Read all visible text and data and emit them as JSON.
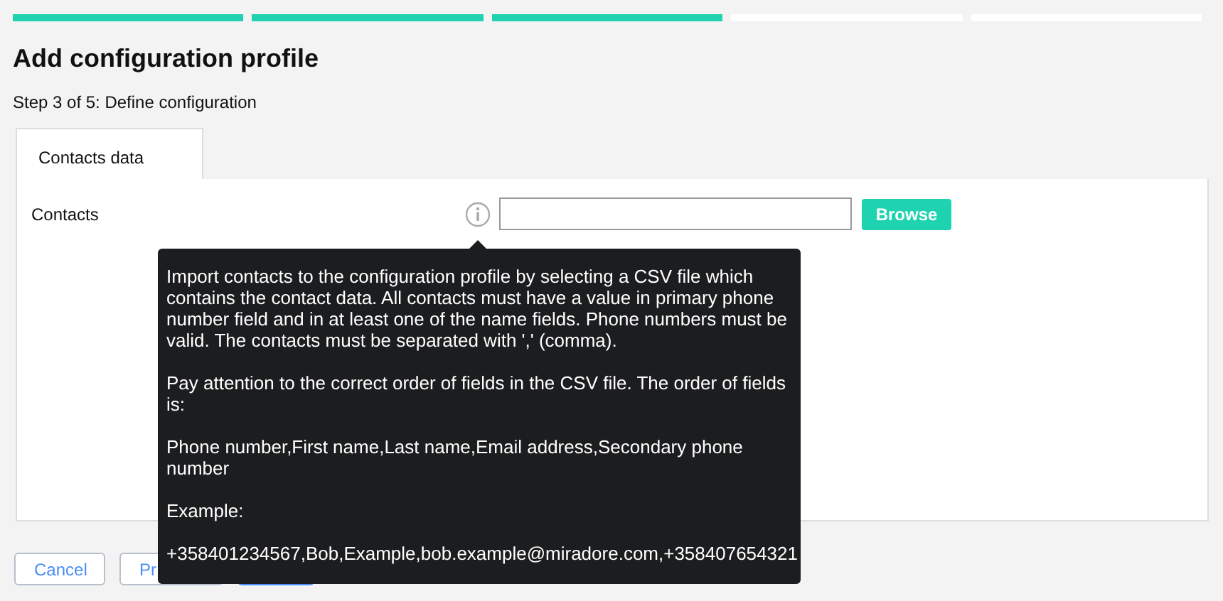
{
  "steps": [
    {
      "done": true
    },
    {
      "done": true
    },
    {
      "done": true
    },
    {
      "done": false
    },
    {
      "done": false
    }
  ],
  "title": "Add configuration profile",
  "subtitle": "Step 3 of 5: Define configuration",
  "tabs": [
    {
      "label": "Contacts data",
      "selected": true
    }
  ],
  "form": {
    "label": "Contacts",
    "browse": "Browse"
  },
  "tooltip": {
    "paragraphs": [
      "Import contacts to the configuration profile by selecting a CSV file which contains the contact data. All contacts must have a value in primary phone number field and in at least one of the name fields. Phone numbers must be valid. The contacts must be separated with ',' (comma).",
      "Pay attention to the correct order of fields in the CSV file. The order of fields is:",
      "Phone number,First name,Last name,Email address,Secondary phone number",
      "Example:",
      "+358401234567,Bob,Example,bob.example@miradore.com,+358407654321"
    ]
  },
  "buttons": [
    {
      "label": "Cancel",
      "kind": "secondary"
    },
    {
      "label": "Pr",
      "kind": "secondary"
    },
    {
      "kind": "primary"
    }
  ]
}
